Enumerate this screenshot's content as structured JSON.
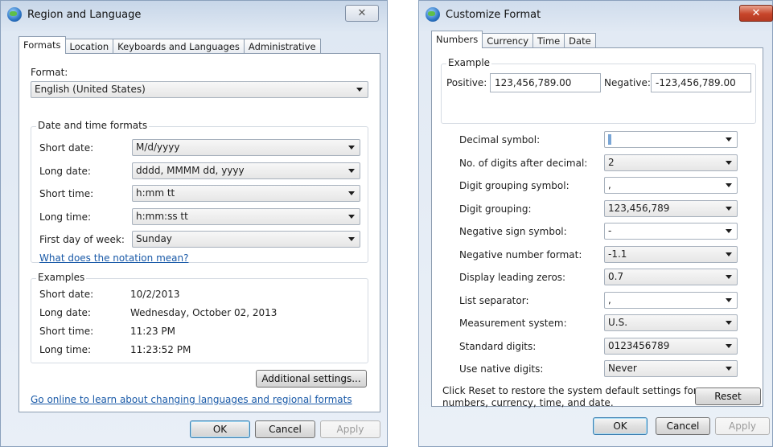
{
  "region": {
    "title": "Region and Language",
    "close_glyph": "✕",
    "tabs": [
      "Formats",
      "Location",
      "Keyboards and Languages",
      "Administrative"
    ],
    "format_label": "Format:",
    "format_value": "English (United States)",
    "dt_group": "Date and time formats",
    "rows": [
      {
        "label": "Short date:",
        "value": "M/d/yyyy"
      },
      {
        "label": "Long date:",
        "value": "dddd, MMMM dd, yyyy"
      },
      {
        "label": "Short time:",
        "value": "h:mm tt"
      },
      {
        "label": "Long time:",
        "value": "h:mm:ss tt"
      },
      {
        "label": "First day of week:",
        "value": "Sunday"
      }
    ],
    "notation_link": "What does the notation mean?",
    "examples_group": "Examples",
    "examples": [
      {
        "label": "Short date:",
        "value": "10/2/2013"
      },
      {
        "label": "Long date:",
        "value": "Wednesday, October 02, 2013"
      },
      {
        "label": "Short time:",
        "value": "11:23 PM"
      },
      {
        "label": "Long time:",
        "value": "11:23:52 PM"
      }
    ],
    "additional_button": "Additional settings...",
    "online_link": "Go online to learn about changing languages and regional formats",
    "ok": "OK",
    "cancel": "Cancel",
    "apply": "Apply"
  },
  "customize": {
    "title": "Customize Format",
    "close_glyph": "✕",
    "tabs": [
      "Numbers",
      "Currency",
      "Time",
      "Date"
    ],
    "example_group": "Example",
    "positive_label": "Positive:",
    "positive_value": "123,456,789.00",
    "negative_label": "Negative:",
    "negative_value": "-123,456,789.00",
    "settings": [
      {
        "label": "Decimal symbol:",
        "value": "",
        "style": "white"
      },
      {
        "label": "No. of digits after decimal:",
        "value": "2",
        "style": "gray"
      },
      {
        "label": "Digit grouping symbol:",
        "value": ",",
        "style": "white"
      },
      {
        "label": "Digit grouping:",
        "value": "123,456,789",
        "style": "gray"
      },
      {
        "label": "Negative sign symbol:",
        "value": "-",
        "style": "white"
      },
      {
        "label": "Negative number format:",
        "value": "-1.1",
        "style": "gray"
      },
      {
        "label": "Display leading zeros:",
        "value": "0.7",
        "style": "gray"
      },
      {
        "label": "List separator:",
        "value": ",",
        "style": "white"
      },
      {
        "label": "Measurement system:",
        "value": "U.S.",
        "style": "gray"
      },
      {
        "label": "Standard digits:",
        "value": "0123456789",
        "style": "gray"
      },
      {
        "label": "Use native digits:",
        "value": "Never",
        "style": "gray"
      }
    ],
    "reset_text_1": "Click Reset to restore the system default settings for",
    "reset_text_2": "numbers, currency, time, and date.",
    "reset": "Reset",
    "ok": "OK",
    "cancel": "Cancel",
    "apply": "Apply"
  }
}
